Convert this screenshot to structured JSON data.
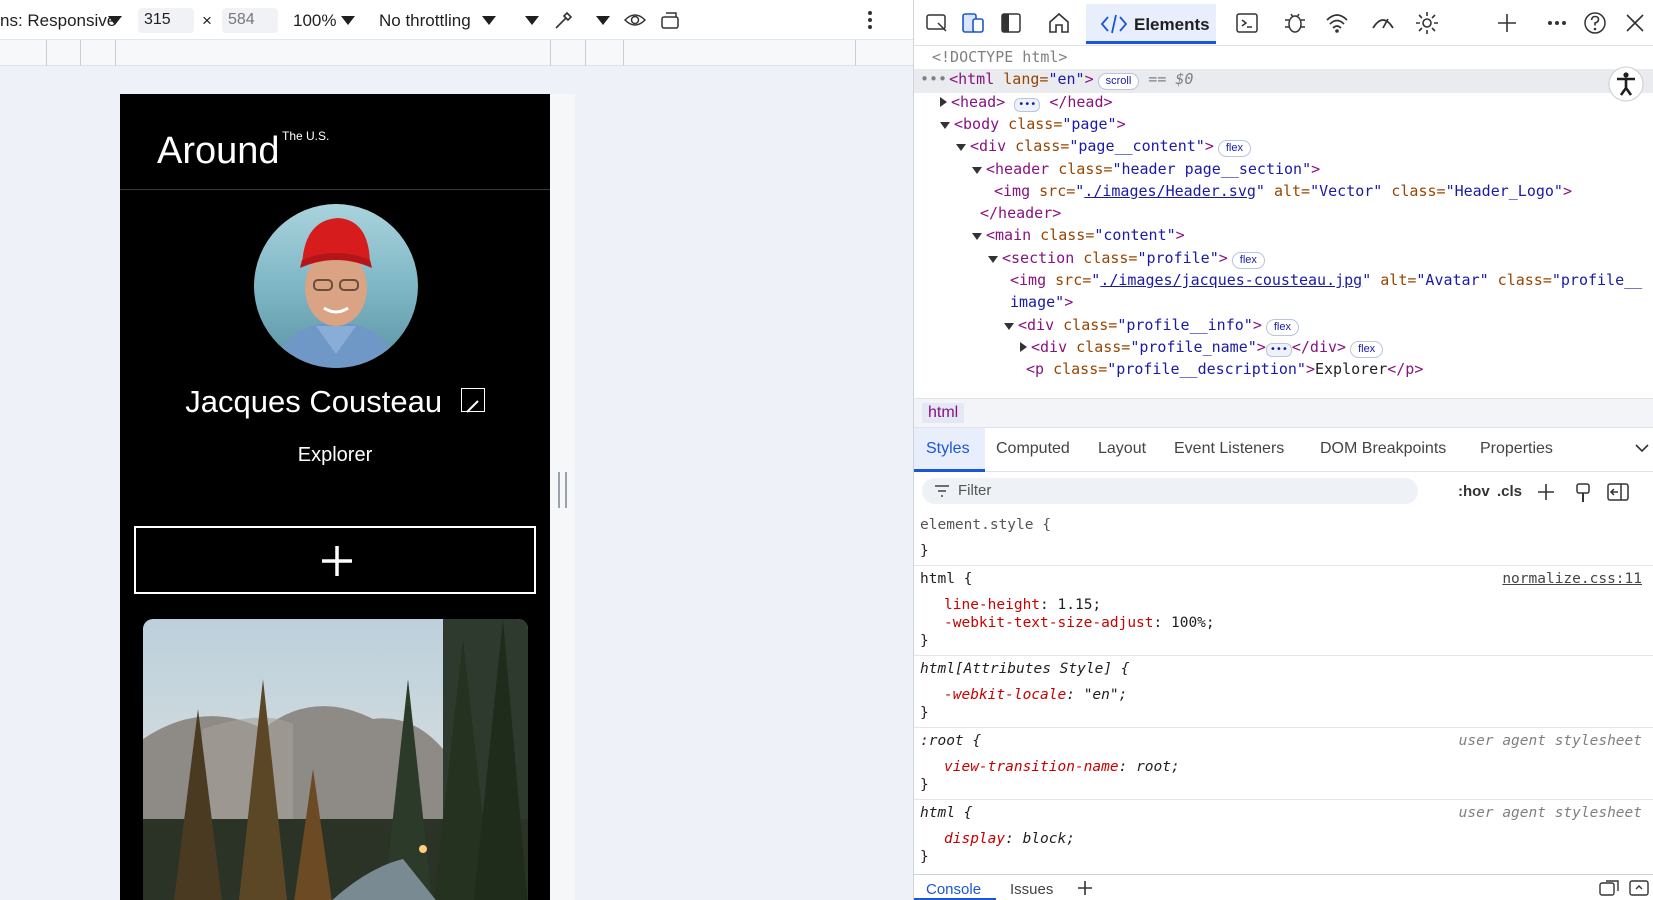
{
  "emulation_toolbar": {
    "dimensions_label": "ns: Responsive",
    "width_value": "315",
    "height_placeholder": "584",
    "times": "×",
    "zoom": "100%",
    "throttling": "No throttling"
  },
  "device_page": {
    "logo_main": "Around",
    "logo_sup": "The U.S.",
    "profile_name": "Jacques Cousteau",
    "profile_description": "Explorer"
  },
  "devtools": {
    "active_tab": "Elements",
    "dom_lines": [
      {
        "doctype": "<!DOCTYPE html>"
      },
      {
        "open": "<html",
        "attr1": " lang=",
        "val1": "\"en\"",
        "close": ">",
        "badge": "scroll",
        "eq": " == $0"
      },
      {
        "open": "<head>",
        "close": "</head>"
      },
      {
        "open": "<body",
        "attr1": " class=",
        "val1": "\"page\"",
        "close": ">"
      },
      {
        "open": "<div",
        "attr1": " class=",
        "val1": "\"page__content\"",
        "close": ">",
        "badge": "flex"
      },
      {
        "open": "<header",
        "attr1": " class=",
        "val1": "\"header page__section\"",
        "close": ">"
      },
      {
        "open": "<img",
        "attr1": " src=",
        "link": "./images/Header.svg",
        "attr2": " alt=",
        "val2": "\"Vector\"",
        "attr3": " class=",
        "val3": "\"Header_Logo\"",
        "close": ">"
      },
      {
        "open": "</header>"
      },
      {
        "open": "<main",
        "attr1": " class=",
        "val1": "\"content\"",
        "close": ">"
      },
      {
        "open": "<section",
        "attr1": " class=",
        "val1": "\"profile\"",
        "close": ">",
        "badge": "flex"
      },
      {
        "open": "<img",
        "attr1": " src=",
        "link": "./images/jacques-cousteau.jpg",
        "attr2": " alt=",
        "val2": "\"Avatar\"",
        "attr3": " class=",
        "val3": "\"profile__"
      },
      {
        "wrap": "image\"",
        "close": ">"
      },
      {
        "open": "<div",
        "attr1": " class=",
        "val1": "\"profile__info\"",
        "close": ">",
        "badge": "flex"
      },
      {
        "open": "<div",
        "attr1": " class=",
        "val1": "\"profile_name\"",
        "close": ">",
        "end": "</div>",
        "badge": "flex"
      },
      {
        "open": "<p",
        "attr1": " class=",
        "val1": "\"profile__description\"",
        "close": ">",
        "text": "Explorer",
        "end": "</p>"
      }
    ],
    "breadcrumb": "html",
    "sub_tabs": [
      "Styles",
      "Computed",
      "Layout",
      "Event Listeners",
      "DOM Breakpoints",
      "Properties"
    ],
    "filter_placeholder": "Filter",
    "hov": ":hov",
    "cls": ".cls",
    "rules": [
      {
        "selector": "element.style {",
        "props": [],
        "close": "}"
      },
      {
        "selector": "html {",
        "source": "normalize.css:11",
        "props": [
          {
            "name": "line-height",
            "value": "1.15;"
          },
          {
            "name": "-webkit-text-size-adjust",
            "value": "100%;"
          }
        ],
        "close": "}"
      },
      {
        "selector": "html[Attributes Style] {",
        "props": [
          {
            "name": "-webkit-locale",
            "value": "\"en\";"
          }
        ],
        "close": "}"
      },
      {
        "selector": ":root {",
        "source": "user agent stylesheet",
        "props": [
          {
            "name": "view-transition-name",
            "value": "root;"
          }
        ],
        "close": "}"
      },
      {
        "selector": "html {",
        "source": "user agent stylesheet",
        "props": [
          {
            "name": "display",
            "value": "block;"
          }
        ],
        "close": "}"
      }
    ],
    "drawer_tabs": [
      "Console",
      "Issues"
    ],
    "colors": {
      "accent": "#1a56d6",
      "tag": "#881280",
      "attr": "#994500",
      "value": "#1a1aa6",
      "prop": "#c80000"
    }
  }
}
